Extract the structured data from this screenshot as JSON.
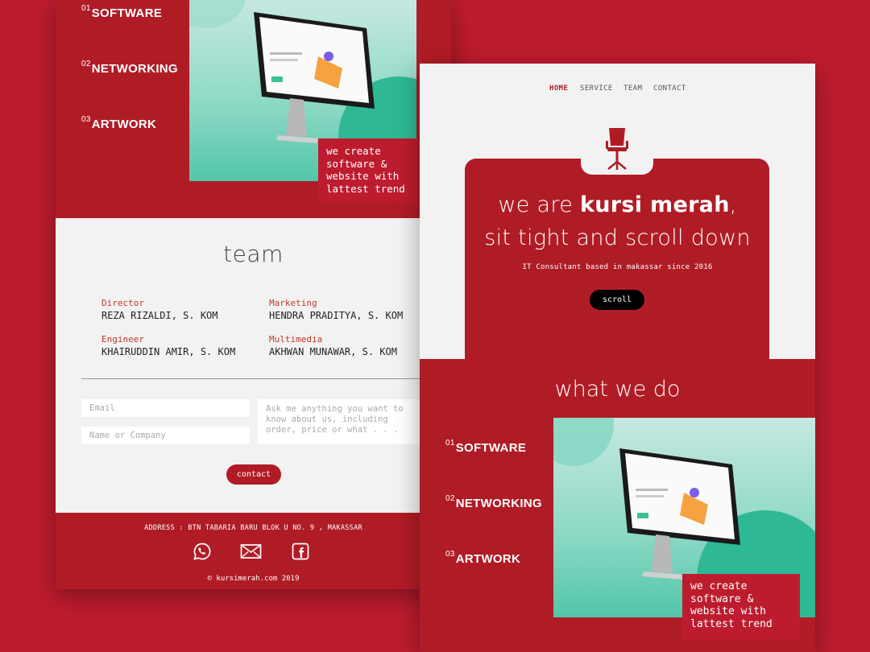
{
  "services": [
    {
      "num": "01",
      "label": "SOFTWARE"
    },
    {
      "num": "02",
      "label": "NETWORKING"
    },
    {
      "num": "03",
      "label": "ARTWORK"
    }
  ],
  "tagline": [
    "we create",
    "software &",
    "website with",
    "lattest trend"
  ],
  "team": {
    "title": "team",
    "members": [
      {
        "role": "Director",
        "name": "REZA RIZALDI, S. KOM"
      },
      {
        "role": "Marketing",
        "name": "HENDRA PRADITYA, S. KOM"
      },
      {
        "role": "Engineer",
        "name": "KHAIRUDDIN AMIR, S. KOM"
      },
      {
        "role": "Multimedia",
        "name": "AKHWAN MUNAWAR, S. KOM"
      }
    ]
  },
  "form": {
    "email_placeholder": "Email",
    "name_placeholder": "Name or Company",
    "message_placeholder": "Ask me anything you want to know about us, including order, price or what . . .",
    "contact_label": "contact"
  },
  "footer": {
    "address": "ADDRESS : BTN TABARIA BARU BLOK U NO. 9 , MAKASSAR",
    "copyright": "© kursimerah.com 2019"
  },
  "nav": [
    {
      "label": "HOME",
      "active": true
    },
    {
      "label": "SERVICE",
      "active": false
    },
    {
      "label": "TEAM",
      "active": false
    },
    {
      "label": "CONTACT",
      "active": false
    }
  ],
  "hero": {
    "line1_pre": "we are ",
    "line1_brand": "kursi merah",
    "line1_post": ",",
    "line2": "sit tight and scroll down",
    "subtitle": "IT Consultant based in makassar since 2016",
    "scroll_label": "scroll"
  },
  "what_we_do": {
    "title": "what we do"
  },
  "colors": {
    "brand_red": "#b01c26",
    "background_red": "#bd1c2e",
    "light": "#f2f2f2",
    "teal": "#52c6a8"
  },
  "icons": [
    "chair-icon",
    "whatsapp-icon",
    "mail-icon",
    "facebook-icon",
    "monitor-illustration"
  ]
}
